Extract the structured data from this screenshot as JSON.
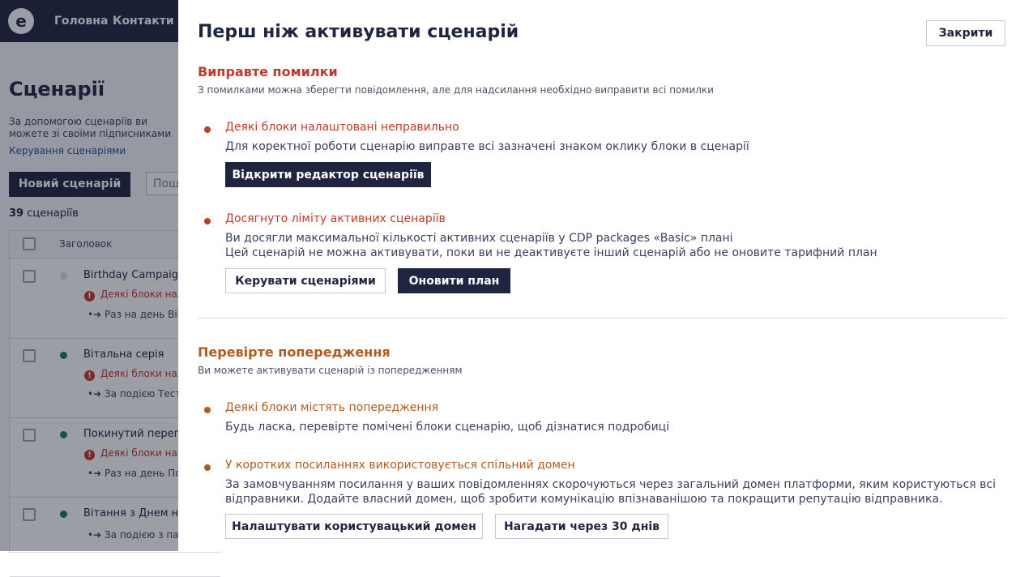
{
  "nav": {
    "logo_letter": "e",
    "items": [
      "Головна",
      "Контакти"
    ]
  },
  "background": {
    "title": "Сценарії",
    "description": "За допомогою сценаріїв ви можете зі своїми підписниками",
    "manage_link": "Керування сценаріями",
    "new_button": "Новий сценарій",
    "search_placeholder": "Пош",
    "count_number": "39",
    "count_label": "сценаріїв",
    "table_header": "Заголовок",
    "rows": [
      {
        "title": "Birthday Campaign",
        "status_color": "#d9dbe0",
        "error": "Деякі блоки нал",
        "meta": "Раз на день Bir"
      },
      {
        "title": "Вітальна серія",
        "status_color": "#1e7a4c",
        "error": "Деякі блоки нал",
        "meta": "За подією Тест"
      },
      {
        "title": "Покинутий перегл",
        "status_color": "#1e7a4c",
        "error": "Деякі блоки нал",
        "meta": "Раз на день По"
      },
      {
        "title": "Вітання з Днем на",
        "status_color": "#1e7a4c",
        "error": "",
        "meta": "За подією з пар"
      }
    ]
  },
  "panel": {
    "title": "Перш ніж активувати сценарій",
    "close_label": "Закрити",
    "errors": {
      "title": "Виправте помилки",
      "subtitle": "З помилками можна зберегти повідомлення, але для надсилання необхідно виправити всі помилки",
      "items": [
        {
          "title": "Деякі блоки налаштовані неправильно",
          "lines": [
            "Для коректної роботи сценарію виправте всі зазначені знаком оклику блоки в сценарії"
          ],
          "buttons": [
            "Відкрити редактор сценаріїв"
          ]
        },
        {
          "title": "Досягнуто ліміту активних сценаріїв",
          "lines": [
            "Ви досягли максимальної кількості активних сценаріїв у CDP packages «Basic» плані",
            "Цей сценарій не можна активувати, поки ви не деактивуєте інший сценарій або не оновите тарифний план"
          ],
          "buttons": [
            "Керувати сценаріями",
            "Оновити план"
          ]
        }
      ]
    },
    "warnings": {
      "title": "Перевірте попередження",
      "subtitle": "Ви можете активувати сценарій із попередженням",
      "items": [
        {
          "title": "Деякі блоки містять попередження",
          "lines": [
            "Будь ласка, перевірте помічені блоки сценарію, щоб дізнатися подробиці"
          ],
          "buttons": []
        },
        {
          "title": "У коротких посиланнях використовується спільний домен",
          "lines": [
            "За замовчуванням посилання у ваших повідомленнях скорочуються через загальний домен платформи, яким користуються всі",
            "відправники. Додайте власний домен, щоб зробити комунікацію впізнаванішою та покращити репутацію відправника."
          ],
          "buttons": [
            "Налаштувати користувацький домен",
            "Нагадати через 30 днів"
          ]
        }
      ]
    }
  },
  "colors": {
    "navy": "#1f2541",
    "error_red": "#c0392b",
    "warning_orange": "#b35a1f"
  }
}
